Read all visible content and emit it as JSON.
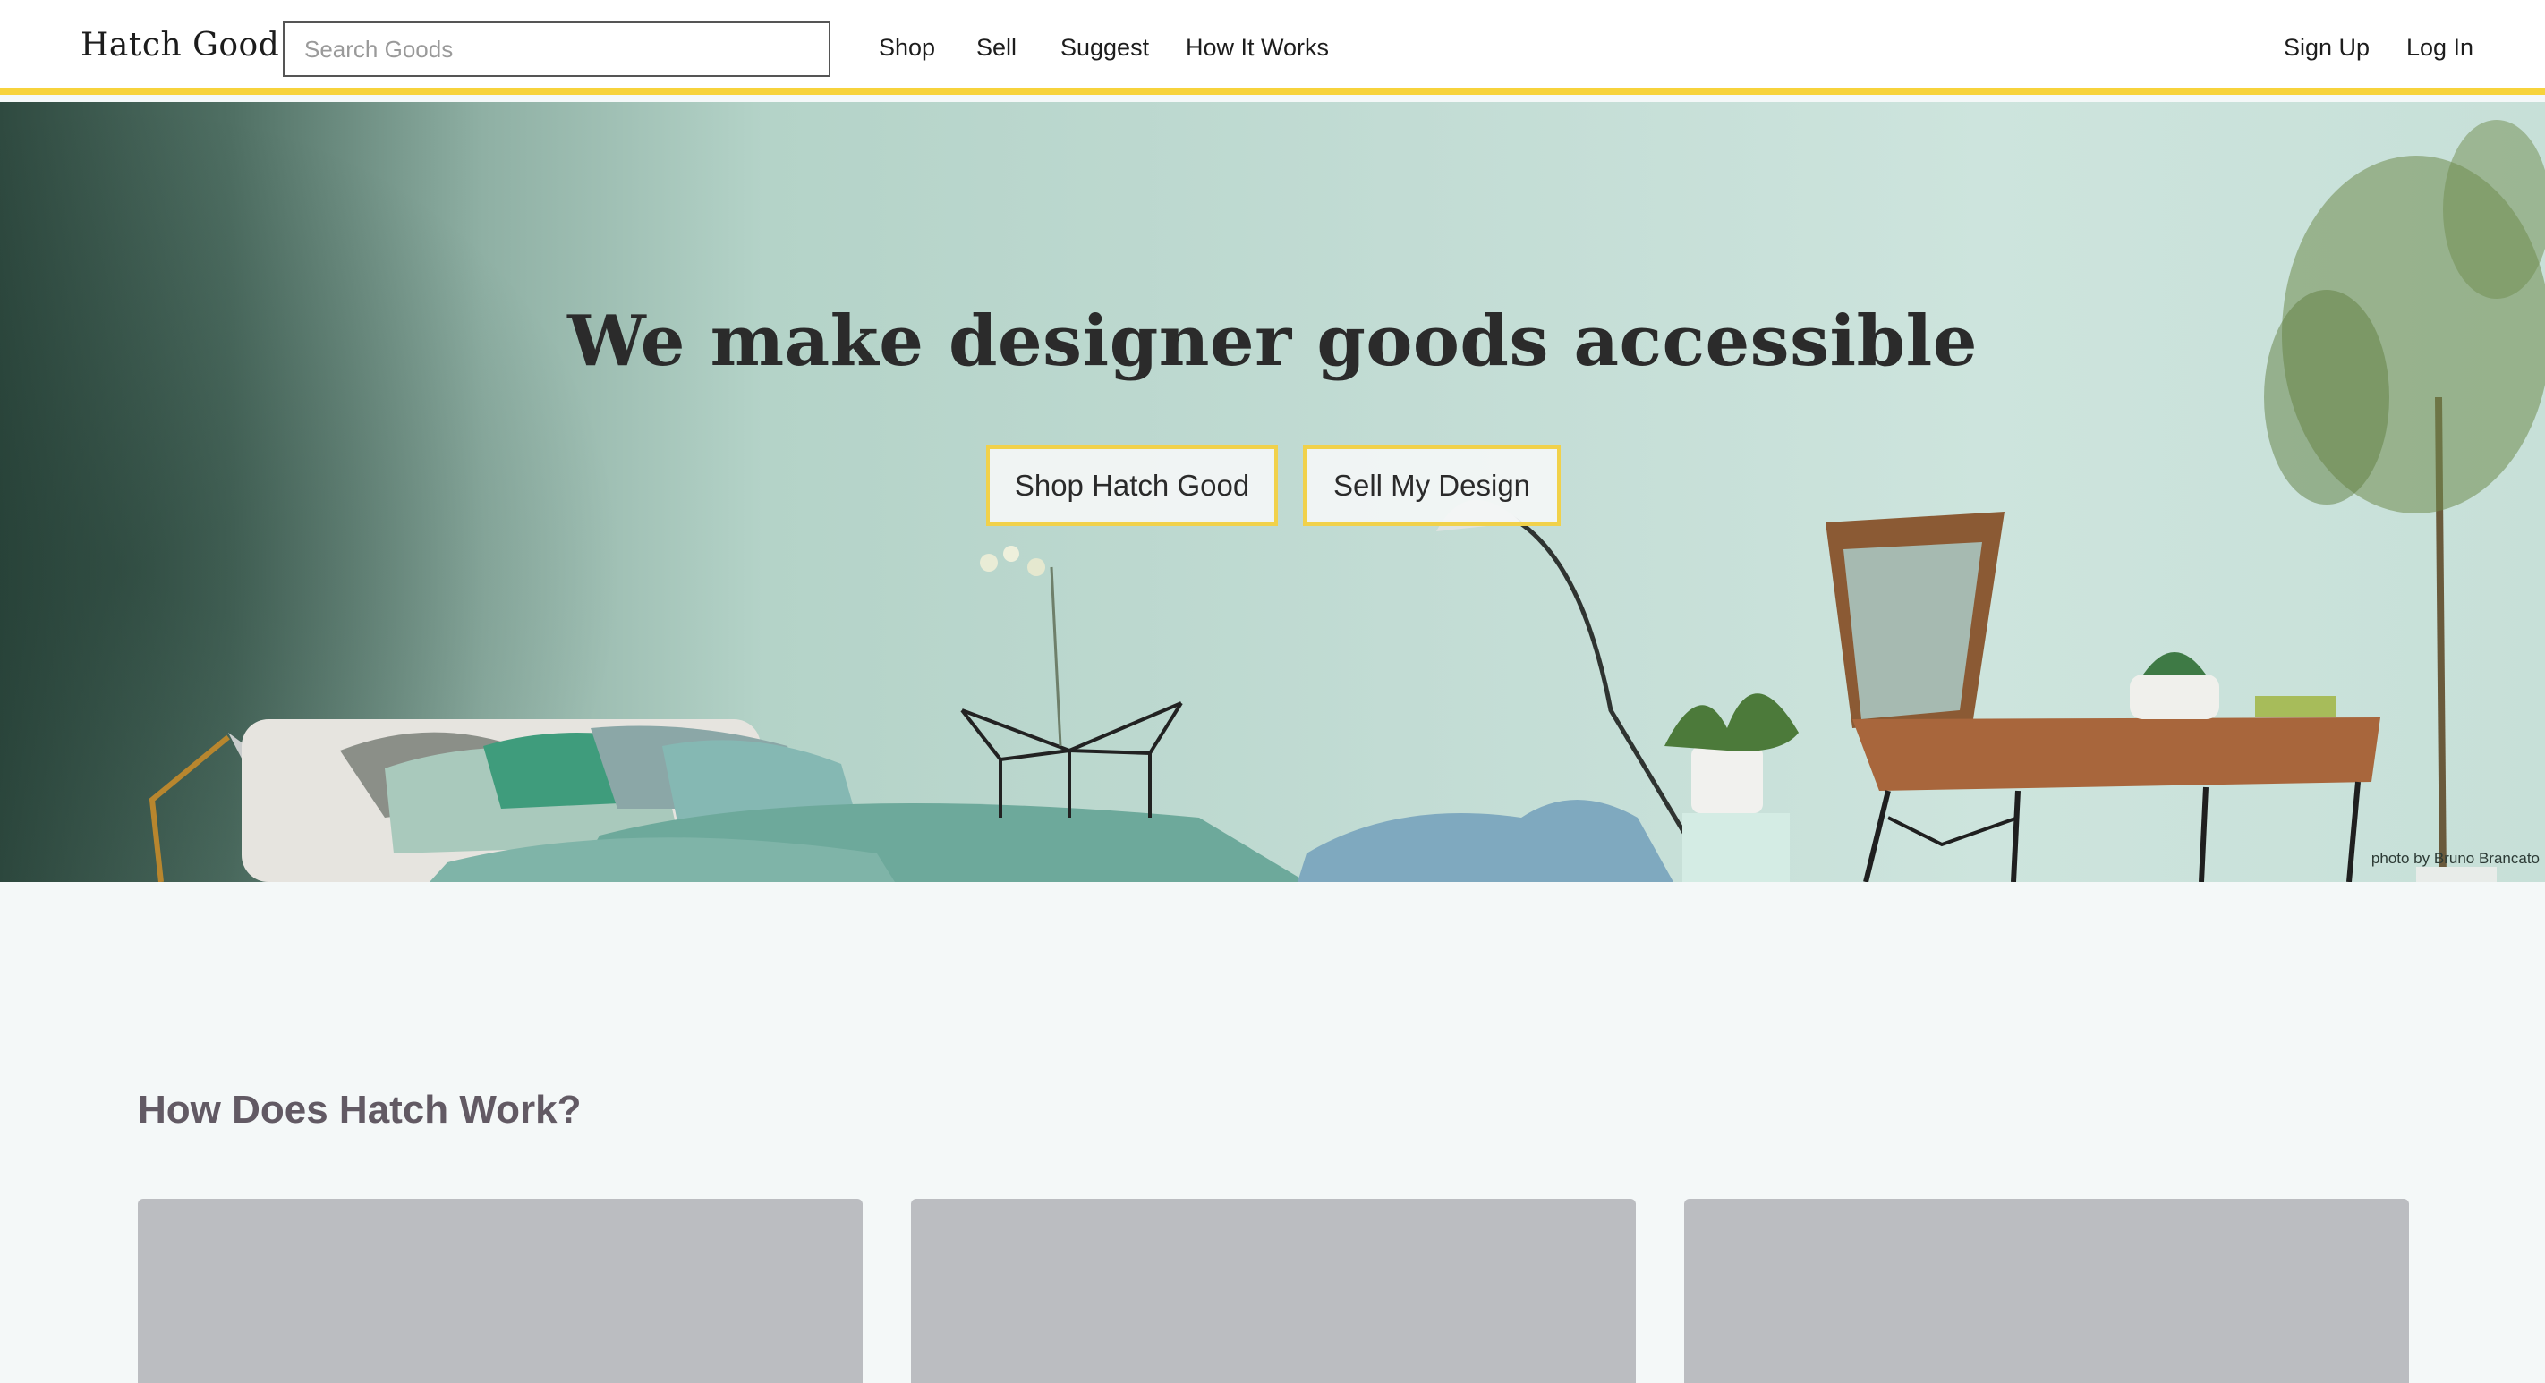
{
  "nav": {
    "brand": "Hatch Good",
    "search_placeholder": "Search Goods",
    "links": [
      "Shop",
      "Sell",
      "Suggest",
      "How It Works"
    ],
    "sign_up": "Sign Up",
    "log_in": "Log In"
  },
  "hero": {
    "title": "We make designer goods accessible",
    "shop_button": "Shop Hatch Good",
    "sell_button": "Sell My Design",
    "photo_credit": "photo by Bruno Brancato"
  },
  "how": {
    "title": "How Does Hatch Work?"
  },
  "colors": {
    "accent": "#f7d33c",
    "heading": "#625a64",
    "card": "#bbbdc1",
    "page_bg": "#f4f8f8"
  }
}
